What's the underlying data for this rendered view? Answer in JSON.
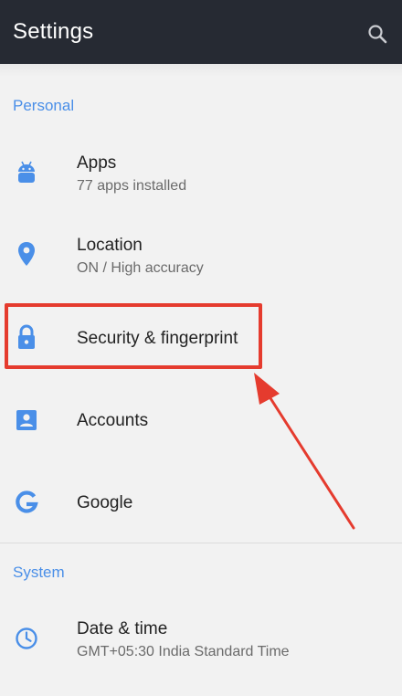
{
  "header": {
    "title": "Settings"
  },
  "icons": {
    "search": "search-icon",
    "apps": "android-icon",
    "location": "location-pin-icon",
    "security": "lock-icon",
    "accounts": "account-box-icon",
    "google": "google-g-icon",
    "datetime": "clock-icon"
  },
  "colors": {
    "topbar": "#262a33",
    "accent": "#4a8fe8",
    "highlight": "#e53b2e",
    "background": "#f2f2f2"
  },
  "sections": {
    "personal": "Personal",
    "system": "System"
  },
  "items": {
    "apps": {
      "label": "Apps",
      "sub": "77 apps installed"
    },
    "location": {
      "label": "Location",
      "sub": "ON / High accuracy"
    },
    "security": {
      "label": "Security & fingerprint"
    },
    "accounts": {
      "label": "Accounts"
    },
    "google": {
      "label": "Google"
    },
    "datetime": {
      "label": "Date & time",
      "sub": "GMT+05:30 India Standard Time"
    }
  }
}
